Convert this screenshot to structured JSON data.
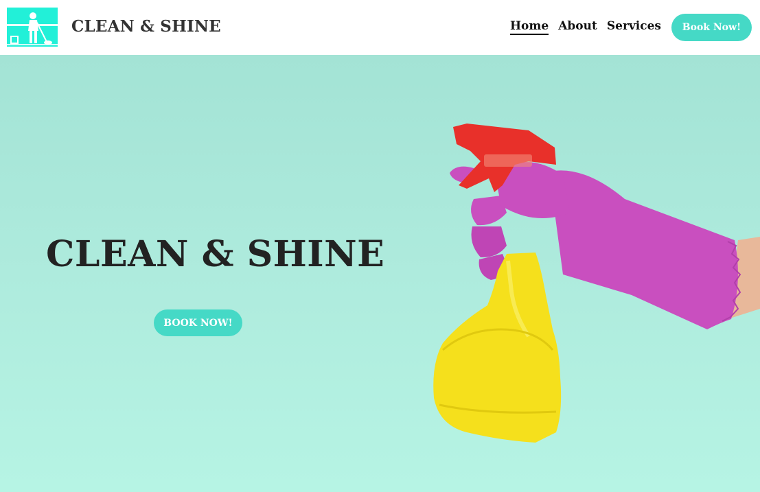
{
  "header": {
    "logo_icon": "cleaner-silhouette-icon",
    "brand": "CLEAN & SHINE",
    "nav": [
      {
        "label": "Home",
        "active": true
      },
      {
        "label": "About",
        "active": false
      },
      {
        "label": "Services",
        "active": false
      }
    ],
    "cta_label": "Book Now!"
  },
  "hero": {
    "title": "CLEAN & SHINE",
    "cta_label": "BOOK NOW!",
    "image_icon": "spray-bottle-gloved-hand-icon"
  },
  "colors": {
    "accent": "#45d9c6",
    "logo_bg": "#22f0d8",
    "hero_bg": "#aeebdd",
    "glove": "#c94fbf",
    "bottle": "#f5e01c",
    "trigger": "#e8302a"
  }
}
